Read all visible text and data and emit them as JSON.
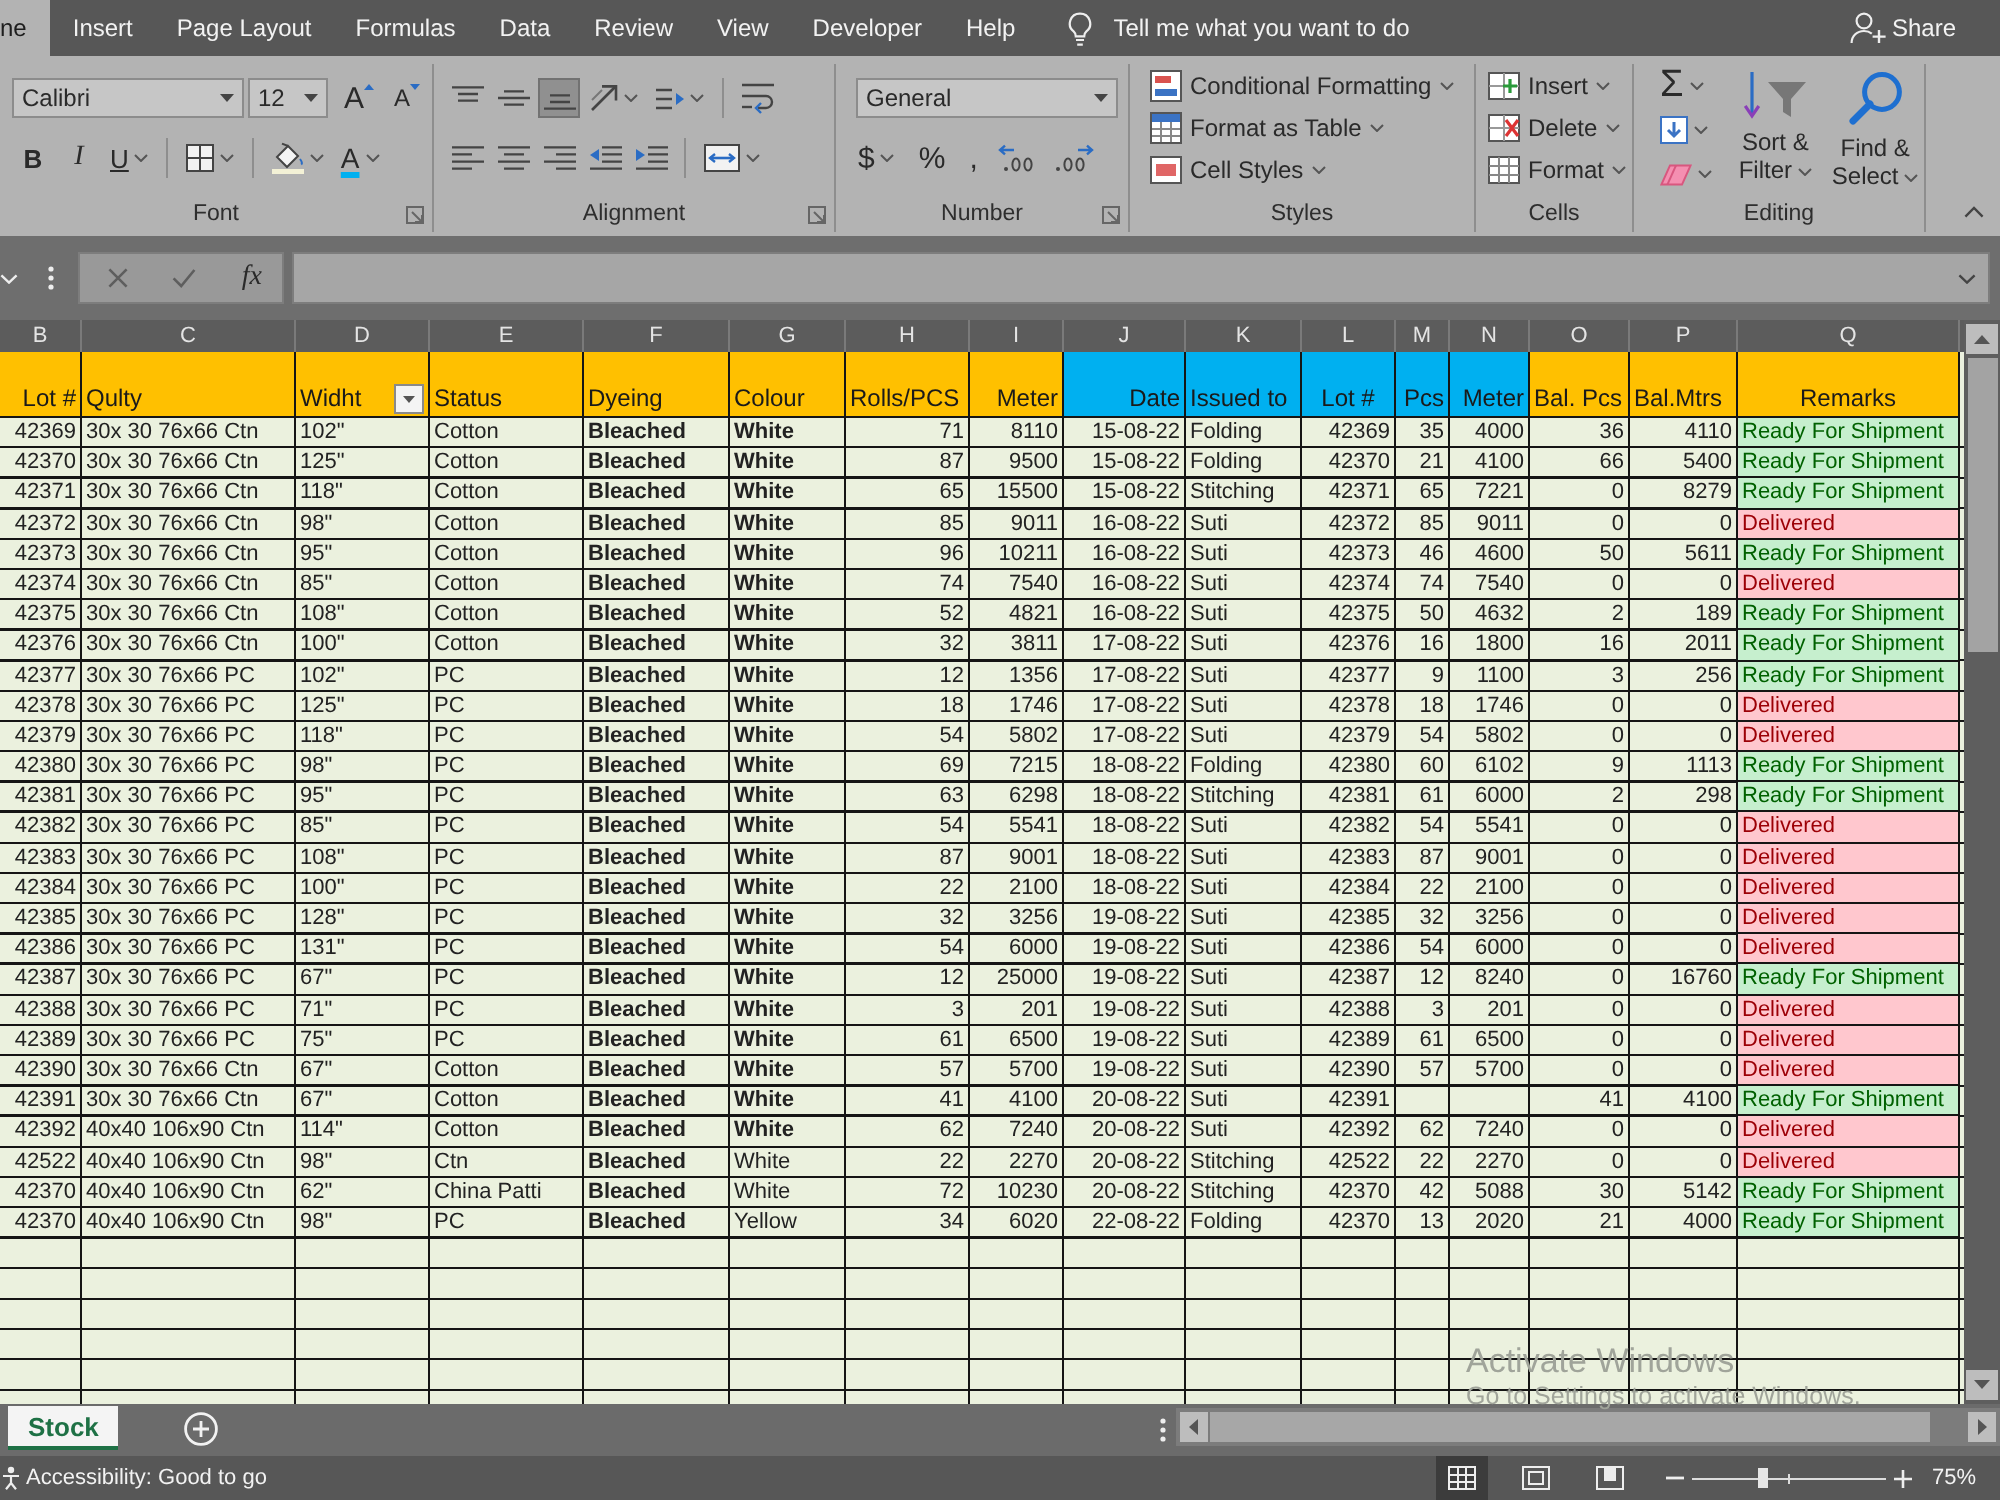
{
  "tabs": [
    {
      "label": "ne",
      "selected": true
    },
    {
      "label": "Insert",
      "selected": false
    },
    {
      "label": "Page Layout",
      "selected": false
    },
    {
      "label": "Formulas",
      "selected": false
    },
    {
      "label": "Data",
      "selected": false
    },
    {
      "label": "Review",
      "selected": false
    },
    {
      "label": "View",
      "selected": false
    },
    {
      "label": "Developer",
      "selected": false
    },
    {
      "label": "Help",
      "selected": false
    }
  ],
  "tell_me": "Tell me what you want to do",
  "share": "Share",
  "ribbon": {
    "font": {
      "label": "Font",
      "font_name": "Calibri",
      "font_size": "12",
      "grow": "A",
      "shrink": "A",
      "bold": "B",
      "italic": "I",
      "underline": "U",
      "font_color": "A"
    },
    "alignment": {
      "label": "Alignment",
      "vertical": [
        {
          "kind": "top",
          "on": false
        },
        {
          "kind": "middle",
          "on": false
        },
        {
          "kind": "bottom",
          "on": true
        }
      ]
    },
    "number": {
      "label": "Number",
      "format": "General",
      "currency": "$",
      "percent": "%",
      "comma": ","
    },
    "styles": {
      "label": "Styles",
      "items": [
        {
          "kind": "conditional",
          "label": "Conditional Formatting"
        },
        {
          "kind": "table",
          "label": "Format as Table"
        },
        {
          "kind": "cell_styles",
          "label": "Cell Styles"
        }
      ]
    },
    "cells": {
      "label": "Cells",
      "items": [
        {
          "kind": "insert",
          "label": "Insert"
        },
        {
          "kind": "delete",
          "label": "Delete"
        },
        {
          "kind": "format",
          "label": "Format"
        }
      ]
    },
    "editing": {
      "label": "Editing",
      "sum": "Σ",
      "sort": "Sort & Filter",
      "find": "Find & Select"
    }
  },
  "formula_bar": {
    "function_label": "fx"
  },
  "table": {
    "columns": [
      {
        "letter": "B",
        "header": "Lot #",
        "color": "#ffc000",
        "filter": false
      },
      {
        "letter": "C",
        "header": "Qulty",
        "color": "#ffc000",
        "filter": false
      },
      {
        "letter": "D",
        "header": "Widht",
        "color": "#ffc000",
        "filter": true
      },
      {
        "letter": "E",
        "header": "Status",
        "color": "#ffc000",
        "filter": false
      },
      {
        "letter": "F",
        "header": "Dyeing",
        "color": "#ffc000",
        "filter": false
      },
      {
        "letter": "G",
        "header": "Colour",
        "color": "#ffc000",
        "filter": false
      },
      {
        "letter": "H",
        "header": "Rolls/PCS",
        "color": "#ffc000",
        "filter": false
      },
      {
        "letter": "I",
        "header": "Meter",
        "color": "#ffc000",
        "filter": false
      },
      {
        "letter": "J",
        "header": "Date",
        "color": "#00b0f0",
        "filter": false
      },
      {
        "letter": "K",
        "header": "Issued to",
        "color": "#00b0f0",
        "filter": false
      },
      {
        "letter": "L",
        "header": "Lot #",
        "color": "#00b0f0",
        "filter": false
      },
      {
        "letter": "M",
        "header": "Pcs",
        "color": "#00b0f0",
        "filter": false
      },
      {
        "letter": "N",
        "header": "Meter",
        "color": "#00b0f0",
        "filter": false
      },
      {
        "letter": "O",
        "header": "Bal. Pcs",
        "color": "#ffc000",
        "filter": false
      },
      {
        "letter": "P",
        "header": "Bal.Mtrs",
        "color": "#ffc000",
        "filter": false
      },
      {
        "letter": "Q",
        "header": "Remarks",
        "color": "#ffc000",
        "filter": false
      }
    ],
    "rows": [
      {
        "lot": "42369",
        "qulty": "30x 30 76x66 Ctn",
        "widht": "102\"",
        "status": "Cotton",
        "dyeing": "Bleached",
        "colour": "White",
        "colour_bold": true,
        "rolls_pcs": "71",
        "meter": "8110",
        "date": "15-08-22",
        "issued_to": "Folding",
        "issued_lot": "42369",
        "pcs": "35",
        "issued_meter": "4000",
        "bal_pcs": "36",
        "bal_mtrs": "4110",
        "remarks": {
          "text": "Ready For Shipment",
          "kind": "good"
        }
      },
      {
        "lot": "42370",
        "qulty": "30x 30 76x66 Ctn",
        "widht": "125\"",
        "status": "Cotton",
        "dyeing": "Bleached",
        "colour": "White",
        "colour_bold": true,
        "rolls_pcs": "87",
        "meter": "9500",
        "date": "15-08-22",
        "issued_to": "Folding",
        "issued_lot": "42370",
        "pcs": "21",
        "issued_meter": "4100",
        "bal_pcs": "66",
        "bal_mtrs": "5400",
        "remarks": {
          "text": "Ready For Shipment",
          "kind": "good"
        }
      },
      {
        "lot": "42371",
        "qulty": "30x 30 76x66 Ctn",
        "widht": "118\"",
        "status": "Cotton",
        "dyeing": "Bleached",
        "colour": "White",
        "colour_bold": true,
        "rolls_pcs": "65",
        "meter": "15500",
        "date": "15-08-22",
        "issued_to": "Stitching",
        "issued_lot": "42371",
        "pcs": "65",
        "issued_meter": "7221",
        "bal_pcs": "0",
        "bal_mtrs": "8279",
        "remarks": {
          "text": "Ready For Shipment",
          "kind": "good"
        }
      },
      {
        "lot": "42372",
        "qulty": "30x 30 76x66 Ctn",
        "widht": "98\"",
        "status": "Cotton",
        "dyeing": "Bleached",
        "colour": "White",
        "colour_bold": true,
        "rolls_pcs": "85",
        "meter": "9011",
        "date": "16-08-22",
        "issued_to": "Suti",
        "issued_lot": "42372",
        "pcs": "85",
        "issued_meter": "9011",
        "bal_pcs": "0",
        "bal_mtrs": "0",
        "remarks": {
          "text": "Delivered",
          "kind": "bad"
        }
      },
      {
        "lot": "42373",
        "qulty": "30x 30 76x66 Ctn",
        "widht": "95\"",
        "status": "Cotton",
        "dyeing": "Bleached",
        "colour": "White",
        "colour_bold": true,
        "rolls_pcs": "96",
        "meter": "10211",
        "date": "16-08-22",
        "issued_to": "Suti",
        "issued_lot": "42373",
        "pcs": "46",
        "issued_meter": "4600",
        "bal_pcs": "50",
        "bal_mtrs": "5611",
        "remarks": {
          "text": "Ready For Shipment",
          "kind": "good"
        }
      },
      {
        "lot": "42374",
        "qulty": "30x 30 76x66 Ctn",
        "widht": "85\"",
        "status": "Cotton",
        "dyeing": "Bleached",
        "colour": "White",
        "colour_bold": true,
        "rolls_pcs": "74",
        "meter": "7540",
        "date": "16-08-22",
        "issued_to": "Suti",
        "issued_lot": "42374",
        "pcs": "74",
        "issued_meter": "7540",
        "bal_pcs": "0",
        "bal_mtrs": "0",
        "remarks": {
          "text": "Delivered",
          "kind": "bad"
        }
      },
      {
        "lot": "42375",
        "qulty": "30x 30 76x66 Ctn",
        "widht": "108\"",
        "status": "Cotton",
        "dyeing": "Bleached",
        "colour": "White",
        "colour_bold": true,
        "rolls_pcs": "52",
        "meter": "4821",
        "date": "16-08-22",
        "issued_to": "Suti",
        "issued_lot": "42375",
        "pcs": "50",
        "issued_meter": "4632",
        "bal_pcs": "2",
        "bal_mtrs": "189",
        "remarks": {
          "text": "Ready For Shipment",
          "kind": "good"
        }
      },
      {
        "lot": "42376",
        "qulty": "30x 30 76x66 Ctn",
        "widht": "100\"",
        "status": "Cotton",
        "dyeing": "Bleached",
        "colour": "White",
        "colour_bold": true,
        "rolls_pcs": "32",
        "meter": "3811",
        "date": "17-08-22",
        "issued_to": "Suti",
        "issued_lot": "42376",
        "pcs": "16",
        "issued_meter": "1800",
        "bal_pcs": "16",
        "bal_mtrs": "2011",
        "remarks": {
          "text": "Ready For Shipment",
          "kind": "good"
        }
      },
      {
        "lot": "42377",
        "qulty": "30x 30 76x66 PC",
        "widht": "102\"",
        "status": "PC",
        "dyeing": "Bleached",
        "colour": "White",
        "colour_bold": true,
        "rolls_pcs": "12",
        "meter": "1356",
        "date": "17-08-22",
        "issued_to": "Suti",
        "issued_lot": "42377",
        "pcs": "9",
        "issued_meter": "1100",
        "bal_pcs": "3",
        "bal_mtrs": "256",
        "remarks": {
          "text": "Ready For Shipment",
          "kind": "good"
        }
      },
      {
        "lot": "42378",
        "qulty": "30x 30 76x66 PC",
        "widht": "125\"",
        "status": "PC",
        "dyeing": "Bleached",
        "colour": "White",
        "colour_bold": true,
        "rolls_pcs": "18",
        "meter": "1746",
        "date": "17-08-22",
        "issued_to": "Suti",
        "issued_lot": "42378",
        "pcs": "18",
        "issued_meter": "1746",
        "bal_pcs": "0",
        "bal_mtrs": "0",
        "remarks": {
          "text": "Delivered",
          "kind": "bad"
        }
      },
      {
        "lot": "42379",
        "qulty": "30x 30 76x66 PC",
        "widht": "118\"",
        "status": "PC",
        "dyeing": "Bleached",
        "colour": "White",
        "colour_bold": true,
        "rolls_pcs": "54",
        "meter": "5802",
        "date": "17-08-22",
        "issued_to": "Suti",
        "issued_lot": "42379",
        "pcs": "54",
        "issued_meter": "5802",
        "bal_pcs": "0",
        "bal_mtrs": "0",
        "remarks": {
          "text": "Delivered",
          "kind": "bad"
        }
      },
      {
        "lot": "42380",
        "qulty": "30x 30 76x66 PC",
        "widht": "98\"",
        "status": "PC",
        "dyeing": "Bleached",
        "colour": "White",
        "colour_bold": true,
        "rolls_pcs": "69",
        "meter": "7215",
        "date": "18-08-22",
        "issued_to": "Folding",
        "issued_lot": "42380",
        "pcs": "60",
        "issued_meter": "6102",
        "bal_pcs": "9",
        "bal_mtrs": "1113",
        "remarks": {
          "text": "Ready For Shipment",
          "kind": "good"
        }
      },
      {
        "lot": "42381",
        "qulty": "30x 30 76x66 PC",
        "widht": "95\"",
        "status": "PC",
        "dyeing": "Bleached",
        "colour": "White",
        "colour_bold": true,
        "rolls_pcs": "63",
        "meter": "6298",
        "date": "18-08-22",
        "issued_to": "Stitching",
        "issued_lot": "42381",
        "pcs": "61",
        "issued_meter": "6000",
        "bal_pcs": "2",
        "bal_mtrs": "298",
        "remarks": {
          "text": "Ready For Shipment",
          "kind": "good"
        }
      },
      {
        "lot": "42382",
        "qulty": "30x 30 76x66 PC",
        "widht": "85\"",
        "status": "PC",
        "dyeing": "Bleached",
        "colour": "White",
        "colour_bold": true,
        "rolls_pcs": "54",
        "meter": "5541",
        "date": "18-08-22",
        "issued_to": "Suti",
        "issued_lot": "42382",
        "pcs": "54",
        "issued_meter": "5541",
        "bal_pcs": "0",
        "bal_mtrs": "0",
        "remarks": {
          "text": "Delivered",
          "kind": "bad"
        }
      },
      {
        "lot": "42383",
        "qulty": "30x 30 76x66 PC",
        "widht": "108\"",
        "status": "PC",
        "dyeing": "Bleached",
        "colour": "White",
        "colour_bold": true,
        "rolls_pcs": "87",
        "meter": "9001",
        "date": "18-08-22",
        "issued_to": "Suti",
        "issued_lot": "42383",
        "pcs": "87",
        "issued_meter": "9001",
        "bal_pcs": "0",
        "bal_mtrs": "0",
        "remarks": {
          "text": "Delivered",
          "kind": "bad"
        }
      },
      {
        "lot": "42384",
        "qulty": "30x 30 76x66 PC",
        "widht": "100\"",
        "status": "PC",
        "dyeing": "Bleached",
        "colour": "White",
        "colour_bold": true,
        "rolls_pcs": "22",
        "meter": "2100",
        "date": "18-08-22",
        "issued_to": "Suti",
        "issued_lot": "42384",
        "pcs": "22",
        "issued_meter": "2100",
        "bal_pcs": "0",
        "bal_mtrs": "0",
        "remarks": {
          "text": "Delivered",
          "kind": "bad"
        }
      },
      {
        "lot": "42385",
        "qulty": "30x 30 76x66 PC",
        "widht": "128\"",
        "status": "PC",
        "dyeing": "Bleached",
        "colour": "White",
        "colour_bold": true,
        "rolls_pcs": "32",
        "meter": "3256",
        "date": "19-08-22",
        "issued_to": "Suti",
        "issued_lot": "42385",
        "pcs": "32",
        "issued_meter": "3256",
        "bal_pcs": "0",
        "bal_mtrs": "0",
        "remarks": {
          "text": "Delivered",
          "kind": "bad"
        }
      },
      {
        "lot": "42386",
        "qulty": "30x 30 76x66 PC",
        "widht": "131\"",
        "status": "PC",
        "dyeing": "Bleached",
        "colour": "White",
        "colour_bold": true,
        "rolls_pcs": "54",
        "meter": "6000",
        "date": "19-08-22",
        "issued_to": "Suti",
        "issued_lot": "42386",
        "pcs": "54",
        "issued_meter": "6000",
        "bal_pcs": "0",
        "bal_mtrs": "0",
        "remarks": {
          "text": "Delivered",
          "kind": "bad"
        }
      },
      {
        "lot": "42387",
        "qulty": "30x 30 76x66 PC",
        "widht": "67\"",
        "status": "PC",
        "dyeing": "Bleached",
        "colour": "White",
        "colour_bold": true,
        "rolls_pcs": "12",
        "meter": "25000",
        "date": "19-08-22",
        "issued_to": "Suti",
        "issued_lot": "42387",
        "pcs": "12",
        "issued_meter": "8240",
        "bal_pcs": "0",
        "bal_mtrs": "16760",
        "remarks": {
          "text": "Ready For Shipment",
          "kind": "good"
        }
      },
      {
        "lot": "42388",
        "qulty": "30x 30 76x66 PC",
        "widht": "71\"",
        "status": "PC",
        "dyeing": "Bleached",
        "colour": "White",
        "colour_bold": true,
        "rolls_pcs": "3",
        "meter": "201",
        "date": "19-08-22",
        "issued_to": "Suti",
        "issued_lot": "42388",
        "pcs": "3",
        "issued_meter": "201",
        "bal_pcs": "0",
        "bal_mtrs": "0",
        "remarks": {
          "text": "Delivered",
          "kind": "bad"
        }
      },
      {
        "lot": "42389",
        "qulty": "30x 30 76x66 PC",
        "widht": "75\"",
        "status": "PC",
        "dyeing": "Bleached",
        "colour": "White",
        "colour_bold": true,
        "rolls_pcs": "61",
        "meter": "6500",
        "date": "19-08-22",
        "issued_to": "Suti",
        "issued_lot": "42389",
        "pcs": "61",
        "issued_meter": "6500",
        "bal_pcs": "0",
        "bal_mtrs": "0",
        "remarks": {
          "text": "Delivered",
          "kind": "bad"
        }
      },
      {
        "lot": "42390",
        "qulty": "30x 30 76x66 Ctn",
        "widht": "67\"",
        "status": "Cotton",
        "dyeing": "Bleached",
        "colour": "White",
        "colour_bold": true,
        "rolls_pcs": "57",
        "meter": "5700",
        "date": "19-08-22",
        "issued_to": "Suti",
        "issued_lot": "42390",
        "pcs": "57",
        "issued_meter": "5700",
        "bal_pcs": "0",
        "bal_mtrs": "0",
        "remarks": {
          "text": "Delivered",
          "kind": "bad"
        }
      },
      {
        "lot": "42391",
        "qulty": "30x 30 76x66 Ctn",
        "widht": "67\"",
        "status": "Cotton",
        "dyeing": "Bleached",
        "colour": "White",
        "colour_bold": true,
        "rolls_pcs": "41",
        "meter": "4100",
        "date": "20-08-22",
        "issued_to": "Suti",
        "issued_lot": "42391",
        "bal_pcs": "41",
        "bal_mtrs": "4100",
        "remarks": {
          "text": "Ready For Shipment",
          "kind": "good"
        }
      },
      {
        "lot": "42392",
        "qulty": "40x40 106x90 Ctn",
        "widht": "114\"",
        "status": "Cotton",
        "dyeing": "Bleached",
        "colour": "White",
        "colour_bold": true,
        "rolls_pcs": "62",
        "meter": "7240",
        "date": "20-08-22",
        "issued_to": "Suti",
        "issued_lot": "42392",
        "pcs": "62",
        "issued_meter": "7240",
        "bal_pcs": "0",
        "bal_mtrs": "0",
        "remarks": {
          "text": "Delivered",
          "kind": "bad"
        }
      },
      {
        "lot": "42522",
        "qulty": "40x40 106x90 Ctn",
        "widht": "98\"",
        "status": "Ctn",
        "dyeing": "Bleached",
        "colour": "White",
        "colour_bold": false,
        "rolls_pcs": "22",
        "meter": "2270",
        "date": "20-08-22",
        "issued_to": "Stitching",
        "issued_lot": "42522",
        "pcs": "22",
        "issued_meter": "2270",
        "bal_pcs": "0",
        "bal_mtrs": "0",
        "remarks": {
          "text": "Delivered",
          "kind": "bad"
        }
      },
      {
        "lot": "42370",
        "qulty": "40x40 106x90 Ctn",
        "widht": "62\"",
        "status": "China Patti",
        "dyeing": "Bleached",
        "colour": "White",
        "colour_bold": false,
        "rolls_pcs": "72",
        "meter": "10230",
        "date": "20-08-22",
        "issued_to": "Stitching",
        "issued_lot": "42370",
        "pcs": "42",
        "issued_meter": "5088",
        "bal_pcs": "30",
        "bal_mtrs": "5142",
        "remarks": {
          "text": "Ready For Shipment",
          "kind": "good"
        }
      },
      {
        "lot": "42370",
        "qulty": "40x40 106x90 Ctn",
        "widht": "98\"",
        "status": "PC",
        "dyeing": "Bleached",
        "colour": "Yellow",
        "colour_bold": false,
        "rolls_pcs": "34",
        "meter": "6020",
        "date": "22-08-22",
        "issued_to": "Folding",
        "issued_lot": "42370",
        "pcs": "13",
        "issued_meter": "2020",
        "bal_pcs": "21",
        "bal_mtrs": "4000",
        "remarks": {
          "text": "Ready For Shipment",
          "kind": "good"
        }
      }
    ]
  },
  "sheet_tabs": [
    {
      "label": "Stock",
      "selected": true
    }
  ],
  "status_bar": {
    "accessibility": "Accessibility: Good to go",
    "views": [
      {
        "kind": "normal",
        "selected": true
      },
      {
        "kind": "page_layout",
        "selected": false
      },
      {
        "kind": "page_break",
        "selected": false
      }
    ],
    "zoom_slider": {
      "level": 0.37
    },
    "zoom": "75%"
  },
  "os_overlay": {
    "title": "Activate Windows",
    "message": "Go to Settings to activate Windows."
  }
}
